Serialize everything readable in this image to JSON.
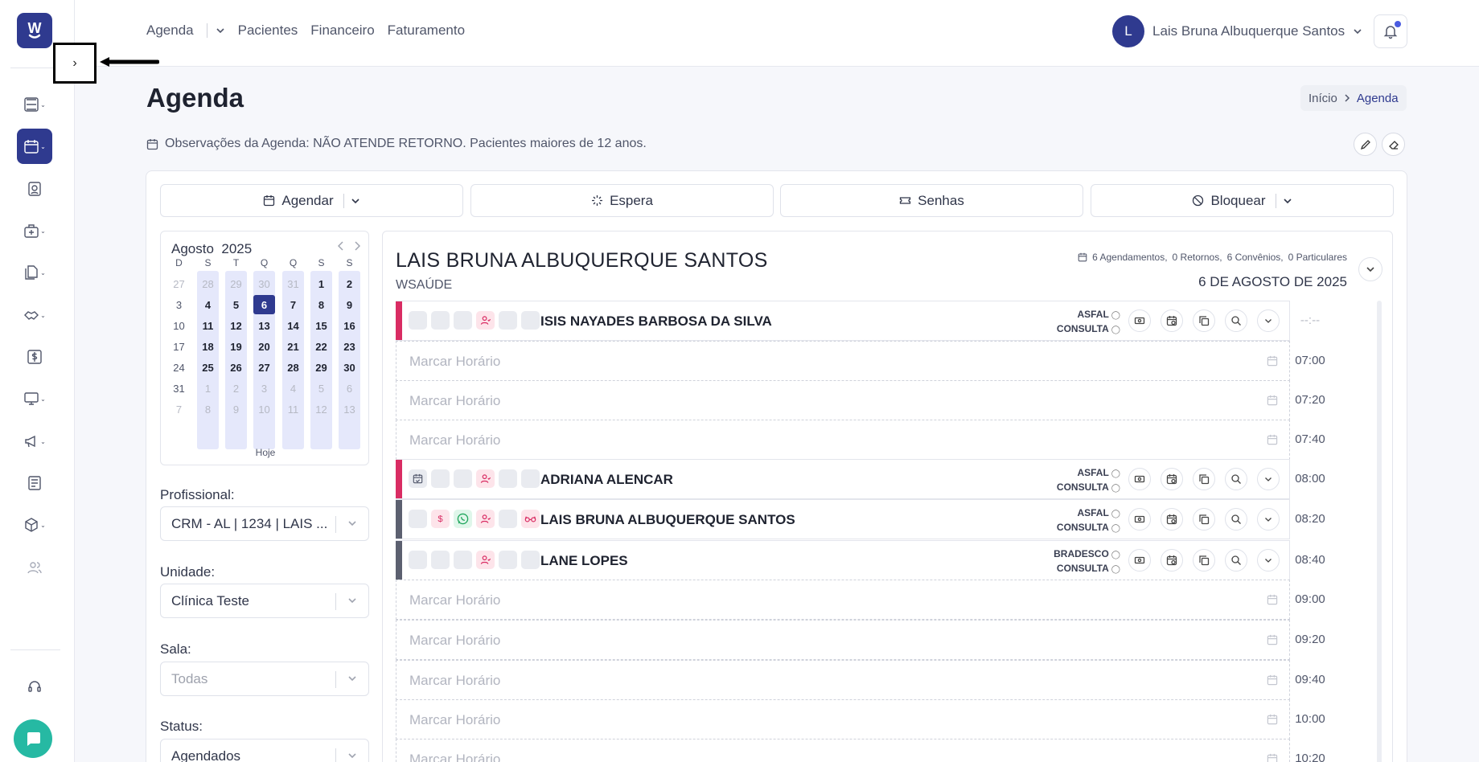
{
  "sidebar": {
    "logo_letter": "W",
    "collapse_symbol": "›",
    "items": [
      {
        "icon": "checklist-icon",
        "has_chevron": true
      },
      {
        "icon": "calendar-icon",
        "has_chevron": true,
        "active": true
      },
      {
        "icon": "patient-badge-icon",
        "has_chevron": false
      },
      {
        "icon": "medical-bag-icon",
        "has_chevron": true
      },
      {
        "icon": "documents-icon",
        "has_chevron": true
      },
      {
        "icon": "handshake-icon",
        "has_chevron": true
      },
      {
        "icon": "dollar-icon",
        "has_chevron": false
      },
      {
        "icon": "monitor-icon",
        "has_chevron": true
      },
      {
        "icon": "megaphone-icon",
        "has_chevron": true
      },
      {
        "icon": "news-icon",
        "has_chevron": false
      },
      {
        "icon": "box-icon",
        "has_chevron": true
      },
      {
        "icon": "users-icon",
        "has_chevron": false
      }
    ],
    "support_icon": "headset-icon",
    "chat_icon": "chat-icon"
  },
  "topbar": {
    "nav": [
      "Agenda",
      "Pacientes",
      "Financeiro",
      "Faturamento"
    ],
    "user_initial": "L",
    "user_name": "Lais Bruna Albuquerque Santos"
  },
  "page": {
    "title": "Agenda",
    "breadcrumb": [
      "Início",
      "Agenda"
    ],
    "observations": "Observações da Agenda: NÃO ATENDE RETORNO. Pacientes maiores de 12 anos."
  },
  "actions": {
    "agendar": "Agendar",
    "espera": "Espera",
    "senhas": "Senhas",
    "bloquear": "Bloquear"
  },
  "calendar": {
    "month": "Agosto",
    "year": "2025",
    "weekdays": [
      "D",
      "S",
      "T",
      "Q",
      "Q",
      "S",
      "S"
    ],
    "weeks": [
      [
        "27",
        "28",
        "29",
        "30",
        "31",
        "1",
        "2"
      ],
      [
        "3",
        "4",
        "5",
        "6",
        "7",
        "8",
        "9"
      ],
      [
        "10",
        "11",
        "12",
        "13",
        "14",
        "15",
        "16"
      ],
      [
        "17",
        "18",
        "19",
        "20",
        "21",
        "22",
        "23"
      ],
      [
        "24",
        "25",
        "26",
        "27",
        "28",
        "29",
        "30"
      ],
      [
        "31",
        "1",
        "2",
        "3",
        "4",
        "5",
        "6"
      ],
      [
        "7",
        "8",
        "9",
        "10",
        "11",
        "12",
        "13"
      ]
    ],
    "today_label": "Hoje",
    "selected_day": "6"
  },
  "filters": {
    "profissional_label": "Profissional:",
    "profissional_value": "CRM - AL | 1234 | LAIS ...",
    "unidade_label": "Unidade:",
    "unidade_value": "Clínica Teste",
    "sala_label": "Sala:",
    "sala_value": "Todas",
    "status_label": "Status:",
    "status_value": "Agendados"
  },
  "schedule": {
    "doctor": "LAIS BRUNA ALBUQUERQUE SANTOS",
    "unit": "WSAÚDE",
    "summary": [
      "6 Agendamentos,",
      "0 Retornos,",
      "6 Convênios,",
      "0 Particulares"
    ],
    "date": "6 DE AGOSTO DE 2025",
    "empty_placeholder": "Marcar Horário",
    "rows": [
      {
        "type": "appt",
        "time": "--:--",
        "name": "ISIS NAYADES BARBOSA DA SILVA",
        "insurance": "ASFAL",
        "kind": "CONSULTA",
        "bar_color": "#d92c63",
        "slots": [
          "",
          "",
          "",
          "patient",
          "",
          ""
        ]
      },
      {
        "type": "empty",
        "time": "07:00"
      },
      {
        "type": "empty",
        "time": "07:20"
      },
      {
        "type": "empty",
        "time": "07:40"
      },
      {
        "type": "appt",
        "time": "08:00",
        "name": "ADRIANA ALENCAR",
        "insurance": "ASFAL",
        "kind": "CONSULTA",
        "bar_color": "#d92c63",
        "slots": [
          "calendar",
          "",
          "",
          "patient",
          "",
          ""
        ]
      },
      {
        "type": "appt",
        "time": "08:20",
        "name": "LAIS BRUNA ALBUQUERQUE SANTOS",
        "insurance": "ASFAL",
        "kind": "CONSULTA",
        "bar_color": "#5c6070",
        "slots": [
          "",
          "money",
          "whatsapp",
          "patient",
          "",
          "glasses"
        ]
      },
      {
        "type": "appt",
        "time": "08:40",
        "name": "LANE LOPES",
        "insurance": "BRADESCO",
        "kind": "CONSULTA",
        "bar_color": "#5c6070",
        "slots": [
          "",
          "",
          "",
          "patient",
          "",
          ""
        ]
      },
      {
        "type": "empty",
        "time": "09:00"
      },
      {
        "type": "empty",
        "time": "09:20"
      },
      {
        "type": "empty",
        "time": "09:40"
      },
      {
        "type": "empty",
        "time": "10:00"
      },
      {
        "type": "empty",
        "time": "10:20"
      }
    ]
  }
}
